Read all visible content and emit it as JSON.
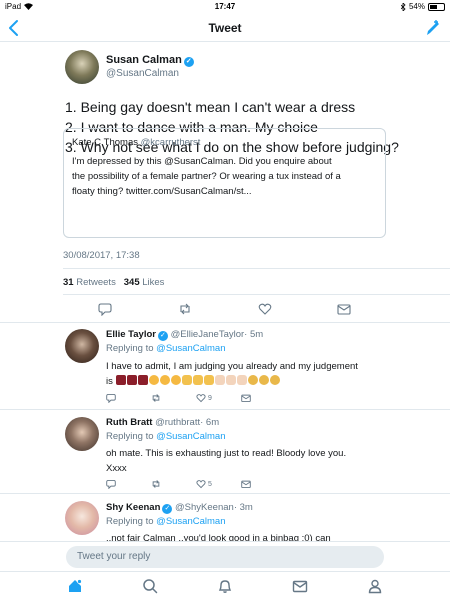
{
  "status_bar": {
    "device": "iPad",
    "time": "17:47",
    "battery": "54%",
    "battery_level": 0.54
  },
  "nav": {
    "title": "Tweet"
  },
  "main_tweet": {
    "name": "Susan Calman",
    "handle": "@SusanCalman",
    "lines": [
      "1. Being gay doesn't mean I can't wear a dress",
      "2. I want to dance with a man. My choice",
      "3. Why not see what I do on the show before judging?"
    ],
    "quote": {
      "name": "Kate C.Thomas",
      "handle": "@kcarrutherst",
      "lines": [
        "I'm depressed by this @SusanCalman. Did you enquire about",
        "the possibility of a female partner? Or wearing a tux instead of a",
        "floaty thing? twitter.com/SusanCalman/st..."
      ]
    },
    "date": "30/08/2017, 17:38",
    "retweets": "31",
    "retweets_label": "Retweets",
    "likes": "345",
    "likes_label": "Likes"
  },
  "replies": [
    {
      "name": "Ellie Taylor",
      "handle": "@EllieJaneTaylor",
      "time": "· 5m",
      "replying_prefix": "Replying to",
      "replying_to": "@SusanCalman",
      "text_line1": "I have to admit, I am judging you already and my judgement",
      "text_line2": "is",
      "like_count": "9"
    },
    {
      "name": "Ruth Bratt",
      "handle": "@ruthbratt",
      "time": "· 6m",
      "replying_prefix": "Replying to",
      "replying_to": "@SusanCalman",
      "text_line1": "oh mate. This is exhausting just to read! Bloody love you.",
      "text_line2": "Xxxx",
      "like_count": "5"
    },
    {
      "name": "Shy Keenan",
      "handle": "@ShyKeenan",
      "time": "· 3m",
      "replying_prefix": "Replying to",
      "replying_to": "@SusanCalman",
      "text_line1": "..not fair Calman ..you'd look good in a binbag :0) can"
    }
  ],
  "reply_input": {
    "placeholder": "Tweet your reply"
  },
  "colors": {
    "accent": "#1da1f2",
    "muted": "#657786",
    "border": "#e1e8ed"
  }
}
